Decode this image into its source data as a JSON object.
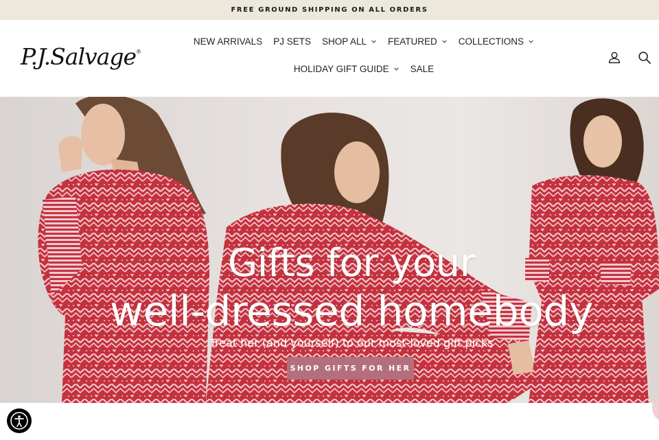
{
  "announcement": {
    "text": "FREE GROUND SHIPPING ON ALL ORDERS"
  },
  "brand": {
    "logo_text": "P.J.Salvage",
    "registered_mark": "®"
  },
  "nav": {
    "row1": [
      {
        "label": "NEW ARRIVALS",
        "has_dropdown": false
      },
      {
        "label": "PJ SETS",
        "has_dropdown": false
      },
      {
        "label": "SHOP ALL",
        "has_dropdown": true
      },
      {
        "label": "FEATURED",
        "has_dropdown": true
      },
      {
        "label": "COLLECTIONS",
        "has_dropdown": true
      }
    ],
    "row2": [
      {
        "label": "HOLIDAY GIFT GUIDE",
        "has_dropdown": true
      },
      {
        "label": "SALE",
        "has_dropdown": false
      }
    ]
  },
  "header_icons": [
    "account-icon",
    "search-icon"
  ],
  "hero": {
    "title_line1": "Gifts for your",
    "title_line2": "well-dressed homebody",
    "subtitle": "Treat her (and yourself) to our most-loved gift picks",
    "cta_label": "SHOP GIFTS FOR HER"
  },
  "colors": {
    "announcement_bg": "#ede8dc",
    "cta_bg": "#b36f7c",
    "pajama_red": "#c4323f",
    "pajama_pink": "#f3c9cf"
  },
  "widgets": {
    "accessibility_icon": "accessibility-icon",
    "chat_icon": "chat-icon"
  }
}
